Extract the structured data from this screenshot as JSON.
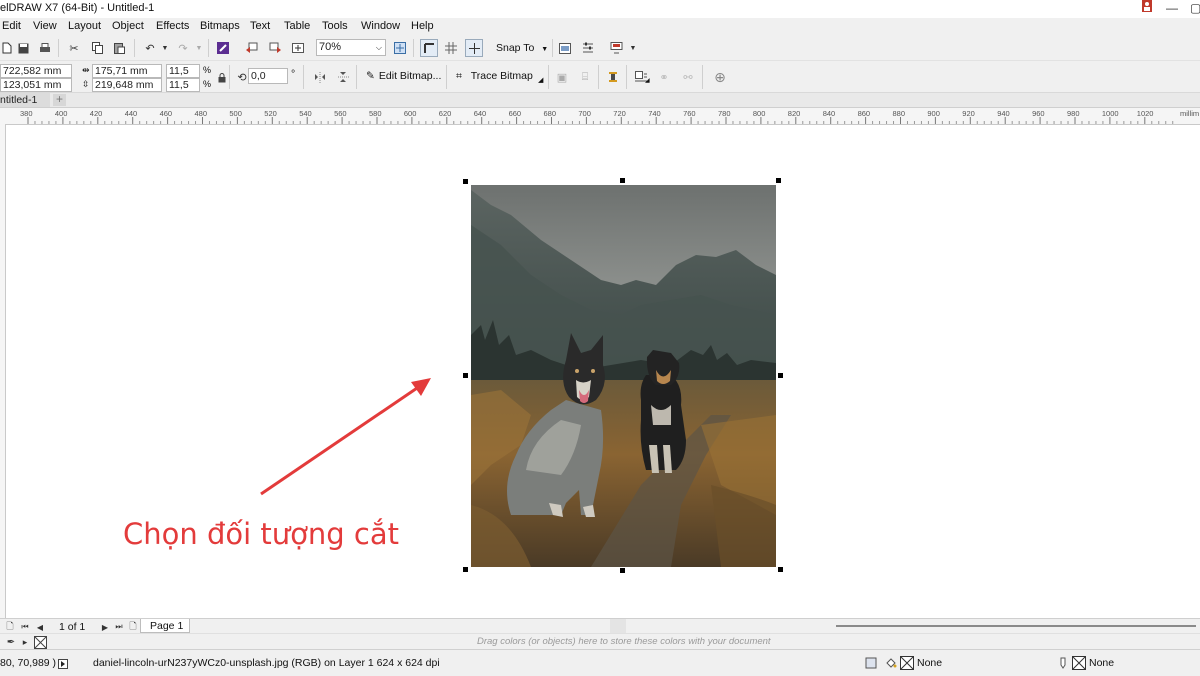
{
  "window": {
    "title": "elDRAW X7 (64-Bit) - Untitled-1"
  },
  "menu": [
    "Edit",
    "View",
    "Layout",
    "Object",
    "Effects",
    "Bitmaps",
    "Text",
    "Table",
    "Tools",
    "Window",
    "Help"
  ],
  "toolbar1": {
    "zoom": "70%",
    "snap_to": "Snap To"
  },
  "propertybar": {
    "x": "722,582 mm",
    "y": "123,051 mm",
    "width": "175,71 mm",
    "height": "219,648 mm",
    "scale_x": "11,5",
    "scale_y": "11,5",
    "percent": "%",
    "rotation": "0,0",
    "degree": "°",
    "edit_bitmap": "Edit Bitmap...",
    "trace_bitmap": "Trace Bitmap"
  },
  "document": {
    "tab": "ntitled-1"
  },
  "ruler": {
    "labels": [
      "380",
      "400",
      "420",
      "440",
      "460",
      "480",
      "500",
      "520",
      "540",
      "560",
      "580",
      "600",
      "620",
      "640",
      "660",
      "680",
      "700",
      "720",
      "740",
      "760",
      "780",
      "800",
      "820",
      "840",
      "860",
      "880",
      "900",
      "920",
      "940",
      "960",
      "980",
      "1000",
      "1020"
    ],
    "unit": "millim"
  },
  "annotation": {
    "text": "Chọn đối tượng cắt"
  },
  "pagebar": {
    "page_count": "1 of 1",
    "page_tab": "Page 1"
  },
  "palette": {
    "hint": "Drag colors (or objects) here to store these colors with your document"
  },
  "status": {
    "coords": "80, 70,989 )",
    "info": "daniel-lincoln-urN237yWCz0-unsplash.jpg (RGB) on Layer 1 624 x 624 dpi",
    "fill": "None",
    "outline": "None"
  },
  "colors": {
    "annotation": "#e33b3b",
    "chrome": "#f0f0f0"
  }
}
